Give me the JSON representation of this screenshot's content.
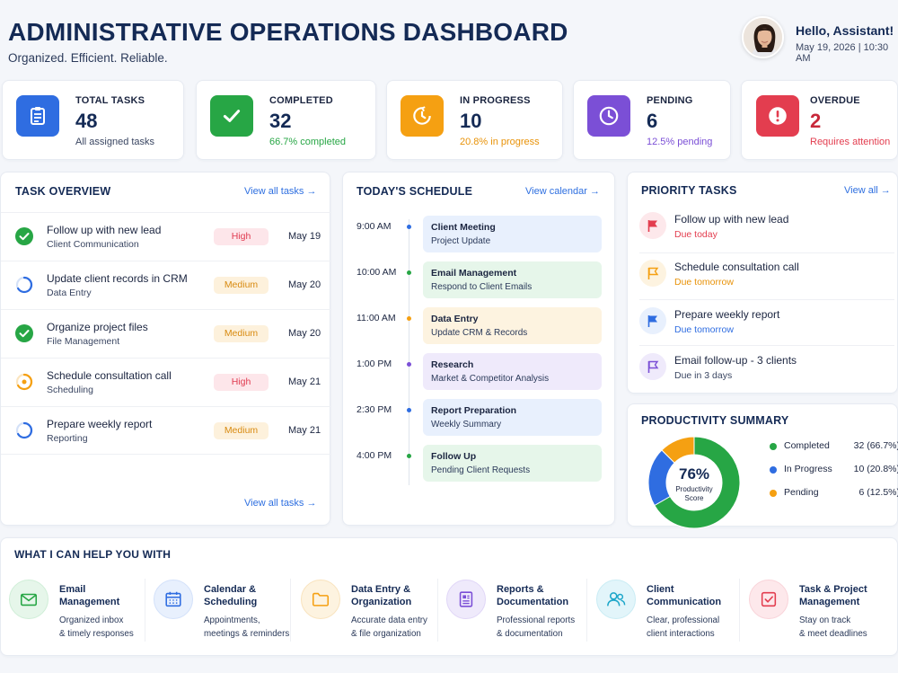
{
  "header": {
    "title": "ADMINISTRATIVE OPERATIONS DASHBOARD",
    "subtitle": "Organized. Efficient. Reliable.",
    "greeting": "Hello, Assistant!",
    "datetime": "May 19, 2026 | 10:30 AM"
  },
  "stats": [
    {
      "label": "TOTAL TASKS",
      "value": "48",
      "sub": "All assigned tasks",
      "color": "#2f6de1",
      "icon": "clipboard-icon"
    },
    {
      "label": "COMPLETED",
      "value": "32",
      "sub": "66.7% completed",
      "color": "#27a645",
      "icon": "check-icon"
    },
    {
      "label": "IN PROGRESS",
      "value": "10",
      "sub": "20.8% in progress",
      "color": "#f5a012",
      "icon": "progress-clock-icon"
    },
    {
      "label": "PENDING",
      "value": "6",
      "sub": "12.5% pending",
      "color": "#7b4fd6",
      "icon": "clock-icon"
    },
    {
      "label": "OVERDUE",
      "value": "2",
      "sub": "Requires attention",
      "color": "#e33d4f",
      "icon": "alert-icon"
    }
  ],
  "task_overview": {
    "title": "TASK OVERVIEW",
    "link": "View all tasks →",
    "footer_link": "View all tasks →",
    "tasks": [
      {
        "name": "Follow up with new lead",
        "category": "Client Communication",
        "priority": "High",
        "date": "May 19",
        "status": "done"
      },
      {
        "name": "Update client records in CRM",
        "category": "Data Entry",
        "priority": "Medium",
        "date": "May 20",
        "status": "progress-blue"
      },
      {
        "name": "Organize project files",
        "category": "File Management",
        "priority": "Medium",
        "date": "May 20",
        "status": "done"
      },
      {
        "name": "Schedule consultation call",
        "category": "Scheduling",
        "priority": "High",
        "date": "May 21",
        "status": "progress-orange"
      },
      {
        "name": "Prepare weekly report",
        "category": "Reporting",
        "priority": "Medium",
        "date": "May 21",
        "status": "progress-blue"
      }
    ]
  },
  "schedule": {
    "title": "TODAY'S SCHEDULE",
    "link": "View calendar →",
    "events": [
      {
        "time": "9:00 AM",
        "title": "Client Meeting",
        "subtitle": "Project Update",
        "bg": "#e8f0fd",
        "dot": "#2f6de1"
      },
      {
        "time": "10:00 AM",
        "title": "Email Management",
        "subtitle": "Respond to Client Emails",
        "bg": "#e6f6ea",
        "dot": "#27a645"
      },
      {
        "time": "11:00 AM",
        "title": "Data Entry",
        "subtitle": "Update CRM & Records",
        "bg": "#fdf3e0",
        "dot": "#f5a012"
      },
      {
        "time": "1:00 PM",
        "title": "Research",
        "subtitle": "Market & Competitor Analysis",
        "bg": "#efeafb",
        "dot": "#7b4fd6"
      },
      {
        "time": "2:30 PM",
        "title": "Report Preparation",
        "subtitle": "Weekly Summary",
        "bg": "#e8f0fd",
        "dot": "#2f6de1"
      },
      {
        "time": "4:00 PM",
        "title": "Follow Up",
        "subtitle": "Pending Client Requests",
        "bg": "#e6f6ea",
        "dot": "#27a645"
      }
    ]
  },
  "priority": {
    "title": "PRIORITY TASKS",
    "link": "View all →",
    "items": [
      {
        "name": "Follow up with new lead",
        "due": "Due today",
        "color": "#e33d4f",
        "bg": "#fde8eb"
      },
      {
        "name": "Schedule consultation call",
        "due": "Due tomorrow",
        "color": "#f5a012",
        "bg": "#fdf3e0"
      },
      {
        "name": "Prepare weekly report",
        "due": "Due tomorrow",
        "color": "#2f6de1",
        "bg": "#e8f0fd"
      },
      {
        "name": "Email follow-up - 3 clients",
        "due": "Due in 3 days",
        "color": "#7b4fd6",
        "bg": "#efeafb"
      }
    ]
  },
  "productivity": {
    "title": "PRODUCTIVITY SUMMARY",
    "score": "76%",
    "score_label_1": "Productivity",
    "score_label_2": "Score",
    "legend": [
      {
        "label": "Completed",
        "value": "32 (66.7%)",
        "color": "#27a645"
      },
      {
        "label": "In Progress",
        "value": "10 (20.8%)",
        "color": "#2f6de1"
      },
      {
        "label": "Pending",
        "value": "6 (12.5%)",
        "color": "#f5a012"
      }
    ]
  },
  "chart_data": {
    "type": "pie",
    "categories": [
      "Completed",
      "In Progress",
      "Pending"
    ],
    "values": [
      32,
      10,
      6
    ],
    "title": "",
    "center_label": "76% Productivity Score"
  },
  "help": {
    "title": "WHAT I CAN HELP YOU WITH",
    "items": [
      {
        "t1": "Email",
        "t2": "Management",
        "d1": "Organized inbox",
        "d2": "& timely responses",
        "color": "#27a645",
        "bg": "#e6f6ea",
        "icon": "mail-icon"
      },
      {
        "t1": "Calendar &",
        "t2": "Scheduling",
        "d1": "Appointments,",
        "d2": "meetings & reminders",
        "color": "#2f6de1",
        "bg": "#e8f0fd",
        "icon": "calendar-icon"
      },
      {
        "t1": "Data Entry &",
        "t2": "Organization",
        "d1": "Accurate data entry",
        "d2": "& file organization",
        "color": "#f5a012",
        "bg": "#fdf3e0",
        "icon": "folder-icon"
      },
      {
        "t1": "Reports &",
        "t2": "Documentation",
        "d1": "Professional reports",
        "d2": "& documentation",
        "color": "#7b4fd6",
        "bg": "#efeafb",
        "icon": "report-icon"
      },
      {
        "t1": "Client",
        "t2": "Communication",
        "d1": "Clear, professional",
        "d2": "client interactions",
        "color": "#1ba6c9",
        "bg": "#e2f5fa",
        "icon": "users-icon"
      },
      {
        "t1": "Task & Project",
        "t2": "Management",
        "d1": "Stay on track",
        "d2": "& meet deadlines",
        "color": "#e33d4f",
        "bg": "#fde8eb",
        "icon": "task-check-icon"
      }
    ]
  }
}
